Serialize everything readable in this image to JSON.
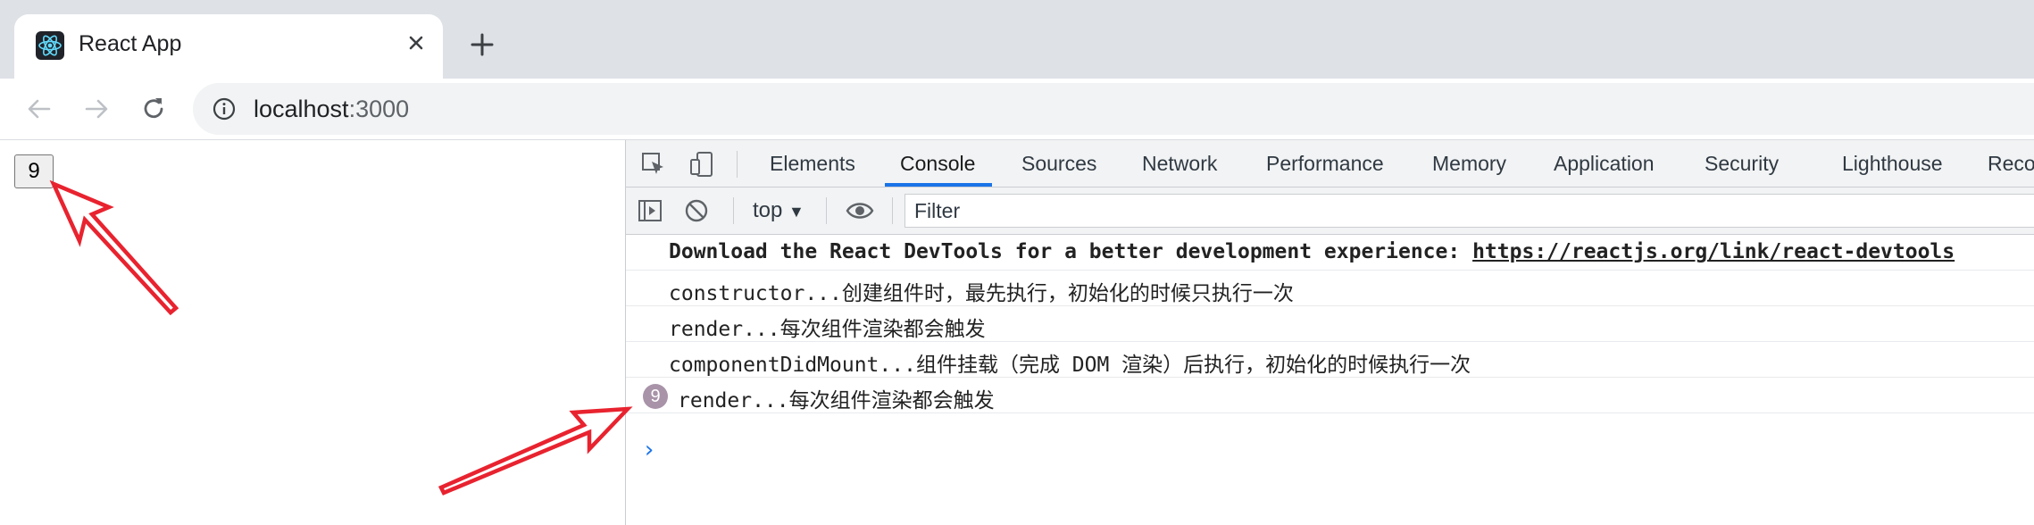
{
  "browser": {
    "tab": {
      "title": "React App",
      "favicon": "react-logo-icon"
    },
    "new_tab_icon": "plus-icon",
    "nav": {
      "back_icon": "arrow-left-icon",
      "forward_icon": "arrow-right-icon",
      "reload_icon": "reload-icon"
    },
    "address": {
      "host": "localhost",
      "port": ":3000",
      "info_icon": "info-icon"
    }
  },
  "page": {
    "counter_button": "9"
  },
  "devtools": {
    "tabs": [
      "Elements",
      "Console",
      "Sources",
      "Network",
      "Performance",
      "Memory",
      "Application",
      "Security",
      "Lighthouse",
      "Reco"
    ],
    "active_tab": "Console",
    "toolbar": {
      "context": "top",
      "filter_placeholder": "Filter"
    },
    "console": {
      "messages": [
        {
          "text": "Download the React DevTools for a better development experience: ",
          "link": "https://reactjs.org/link/react-devtools",
          "bold": true
        },
        {
          "text": "constructor...创建组件时，最先执行，初始化的时候只执行一次"
        },
        {
          "text": "render...每次组件渲染都会触发"
        },
        {
          "text": "componentDidMount...组件挂载（完成 DOM 渲染）后执行，初始化的时候执行一次"
        },
        {
          "text": "render...每次组件渲染都会触发",
          "repeat_count": "9"
        }
      ],
      "prompt": "›"
    }
  },
  "colors": {
    "annotation_arrow": "#e8232f",
    "active_tab_underline": "#1a73e8",
    "repeat_badge": "#a893a8"
  }
}
